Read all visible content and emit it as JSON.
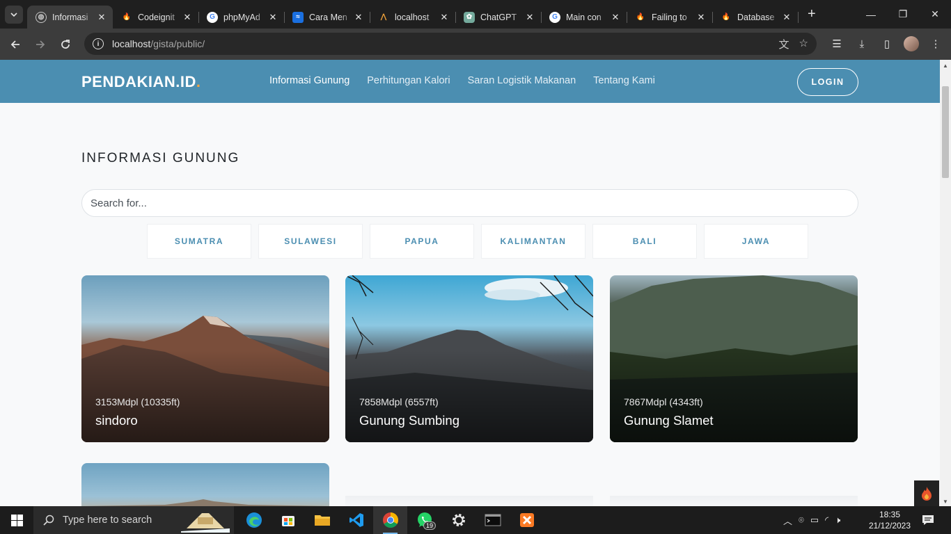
{
  "browser": {
    "tabs": [
      {
        "label": "Informasi",
        "favicon": "globe-icon",
        "active": true
      },
      {
        "label": "Codeignit",
        "favicon": "codeigniter-icon"
      },
      {
        "label": "phpMyAd",
        "favicon": "google-icon"
      },
      {
        "label": "Cara Men",
        "favicon": "wave-icon"
      },
      {
        "label": "localhost",
        "favicon": "xampp-icon"
      },
      {
        "label": "ChatGPT",
        "favicon": "chatgpt-icon"
      },
      {
        "label": "Main con",
        "favicon": "google-icon"
      },
      {
        "label": "Failing to",
        "favicon": "codeigniter-icon"
      },
      {
        "label": "Database",
        "favicon": "codeigniter-icon"
      }
    ],
    "url_host": "localhost",
    "url_path": "/gista/public/"
  },
  "site": {
    "logo": "PENDAKIAN.ID",
    "logo_dot": ".",
    "nav": [
      "Informasi Gunung",
      "Perhitungan Kalori",
      "Saran Logistik Makanan",
      "Tentang Kami"
    ],
    "login": "LOGIN"
  },
  "page": {
    "title": "INFORMASI GUNUNG",
    "search_placeholder": "Search for...",
    "filters": [
      "SUMATRA",
      "SULAWESI",
      "PAPUA",
      "KALIMANTAN",
      "BALI",
      "JAWA"
    ],
    "cards": [
      {
        "elevation": "3153Mdpl (10335ft)",
        "name": "sindoro"
      },
      {
        "elevation": "7858Mdpl (6557ft)",
        "name": "Gunung Sumbing"
      },
      {
        "elevation": "7867Mdpl (4343ft)",
        "name": "Gunung Slamet"
      }
    ]
  },
  "taskbar": {
    "search_text": "Type here to search",
    "whatsapp_badge": "19",
    "time": "18:35",
    "date": "21/12/2023"
  }
}
